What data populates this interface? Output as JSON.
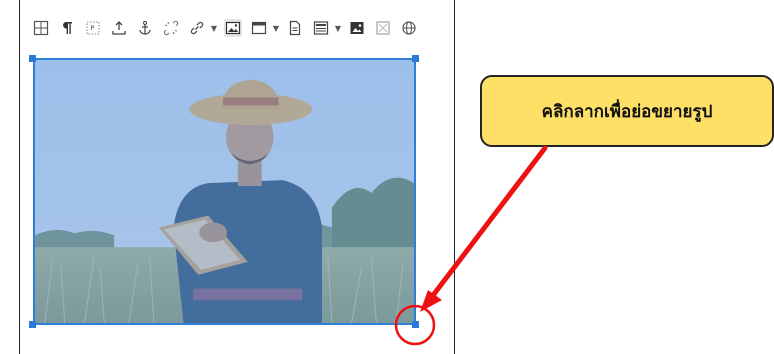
{
  "toolbar": {
    "icons": [
      "table-icon",
      "pilcrow-icon",
      "page-break-icon",
      "upload-icon",
      "anchor-icon",
      "unlink-icon",
      "link-icon",
      "image-icon",
      "media-icon",
      "document-icon",
      "template-icon",
      "insert-image-icon",
      "placeholder-icon",
      "globe-icon"
    ]
  },
  "image": {
    "subject": "farmer-with-clipboard-in-rice-field",
    "selected": true
  },
  "callout": {
    "text": "คลิกลากเพื่อย่อขยายรูป"
  },
  "colors": {
    "selection": "#2f7ed8",
    "callout_fill": "#ffe066",
    "arrow": "#ee1111"
  }
}
